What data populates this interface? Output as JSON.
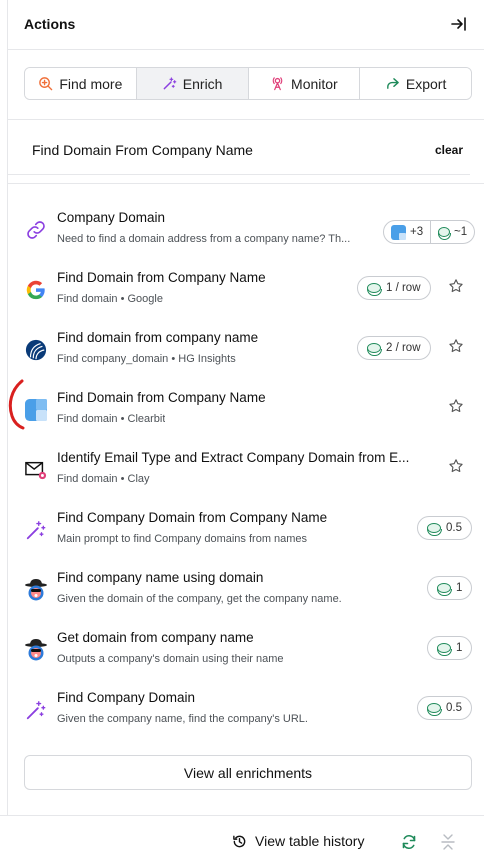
{
  "header": {
    "title": "Actions"
  },
  "tabs": [
    {
      "label": "Find more",
      "icon": "search-plus-icon"
    },
    {
      "label": "Enrich",
      "icon": "magic-wand-icon"
    },
    {
      "label": "Monitor",
      "icon": "signal-tower-icon"
    },
    {
      "label": "Export",
      "icon": "share-arrow-icon"
    }
  ],
  "search": {
    "value": "Find Domain From Company Name",
    "clear_label": "clear"
  },
  "items": [
    {
      "name": "Company Domain",
      "desc": "Need to find a domain address from a company name? Th...",
      "badge_more": "+3",
      "badge_cost": "~1",
      "icon": "link-icon"
    },
    {
      "name": "Find Domain from Company Name",
      "desc": "Find domain • Google",
      "cost": "1 / row",
      "icon": "google-icon"
    },
    {
      "name": "Find domain from company name",
      "desc": "Find company_domain • HG Insights",
      "cost": "2 / row",
      "icon": "hg-insights-icon"
    },
    {
      "name": "Find Domain from Company Name",
      "desc": "Find domain • Clearbit",
      "icon": "clearbit-icon"
    },
    {
      "name": "Identify Email Type and Extract Company Domain from E...",
      "desc": "Find domain • Clay",
      "icon": "email-icon"
    },
    {
      "name": "Find Company Domain from Company Name",
      "desc": "Main prompt to find Company domains from names",
      "cost": "0.5",
      "icon": "magic-wand-icon"
    },
    {
      "name": "Find company name using domain",
      "desc": "Given the domain of the company, get the company name.",
      "cost": "1",
      "icon": "spy-avatar-icon"
    },
    {
      "name": "Get domain from company name",
      "desc": "Outputs a company's domain using their name",
      "cost": "1",
      "icon": "spy-avatar-icon"
    },
    {
      "name": "Find Company Domain",
      "desc": "Given the company name, find the company's URL.",
      "cost": "0.5",
      "icon": "magic-wand-icon"
    }
  ],
  "view_all_label": "View all enrichments",
  "footer": {
    "history_label": "View table history"
  },
  "colors": {
    "accent_green": "#1f8a5a",
    "enrich_purple": "#8b3fe0",
    "annotation_red": "#d9201f"
  }
}
